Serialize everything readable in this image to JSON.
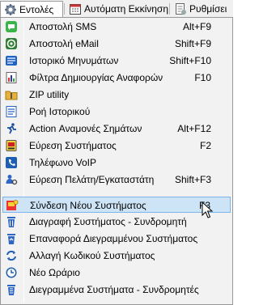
{
  "menubar": {
    "items": [
      {
        "label": "Εντολές",
        "icon": "gear-icon"
      },
      {
        "label": "Αυτόματη Εκκίνηση",
        "icon": "calendar-icon"
      },
      {
        "label": "Ρυθμίσει",
        "icon": "settings-doc-icon"
      }
    ]
  },
  "menu": {
    "items": [
      {
        "label": "Αποστολή SMS",
        "shortcut": "Alt+F9",
        "icon": "sms-icon"
      },
      {
        "label": "Αποστολή eMail",
        "shortcut": "Shift+F9",
        "icon": "email-at-icon"
      },
      {
        "label": "Ιστορικό Μηνυμάτων",
        "shortcut": "Shift+F10",
        "icon": "message-history-icon"
      },
      {
        "label": "Φίλτρα Δημιουργίας Αναφορών",
        "shortcut": "F10",
        "icon": "report-filter-icon"
      },
      {
        "label": "ZIP utility",
        "shortcut": "",
        "icon": "zip-folder-icon"
      },
      {
        "label": "Ροή Ιστορικού",
        "shortcut": "",
        "icon": "history-flow-icon"
      },
      {
        "label": "Action Αναμονές Σημάτων",
        "shortcut": "Alt+F12",
        "icon": "running-person-icon"
      },
      {
        "label": "Εύρεση Συστήματος",
        "shortcut": "F2",
        "icon": "find-system-icon"
      },
      {
        "label": "Τηλέφωνο VoIP",
        "shortcut": "",
        "icon": "voip-phone-icon"
      },
      {
        "label": "Εύρεση Πελάτη/Εγκαταστάτη",
        "shortcut": "Shift+F3",
        "icon": "find-customer-icon"
      },
      {
        "label": "Σύνδεση Νέου Συστήματος",
        "shortcut": "F3",
        "icon": "new-system-icon",
        "highlighted": true
      },
      {
        "label": "Διαγραφή Συστήματος - Συνδρομητή",
        "shortcut": "",
        "icon": "trash-icon"
      },
      {
        "label": "Επαναφορά Διεγραμμένου Συστήματος",
        "shortcut": "",
        "icon": "trash-restore-icon"
      },
      {
        "label": "Αλλαγή Κωδικού Συστήματος",
        "shortcut": "",
        "icon": "refresh-arrows-icon"
      },
      {
        "label": "Νέο Ωράριο",
        "shortcut": "",
        "icon": "clock-icon"
      },
      {
        "label": "Διεγραμμένα Συστήματα - Συνδρομητές",
        "shortcut": "",
        "icon": "trash-list-icon"
      }
    ]
  },
  "colors": {
    "highlight_bg": "#cde3f6",
    "highlight_border": "#7eb4ea",
    "menu_bg": "#f2f2f2"
  }
}
